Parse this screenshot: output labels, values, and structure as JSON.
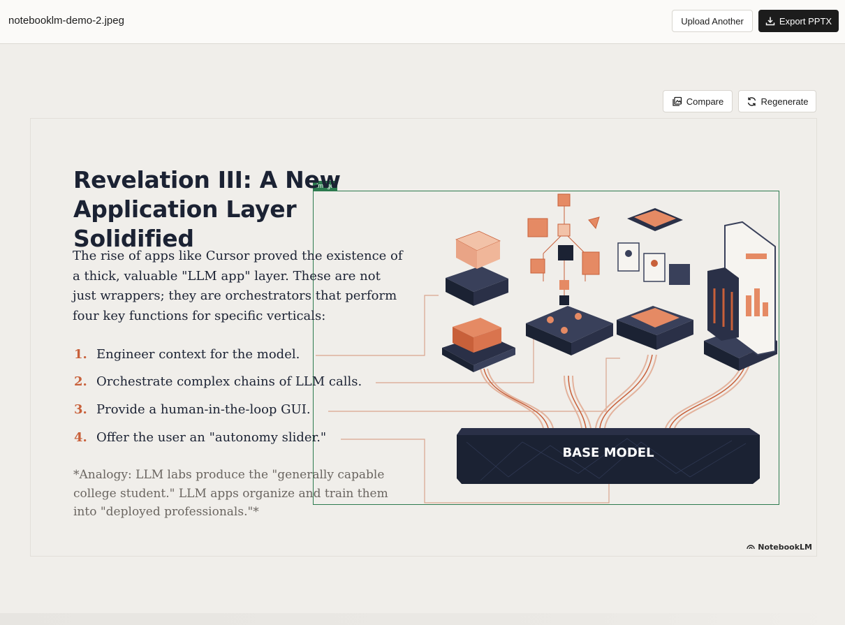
{
  "header": {
    "filename": "notebooklm-demo-2.jpeg",
    "upload_label": "Upload Another",
    "export_label": "Export PPTX"
  },
  "toolbar": {
    "compare_label": "Compare",
    "regenerate_label": "Regenerate"
  },
  "slide": {
    "title": "Revelation III: A New Application Layer Solidified",
    "intro": "The rise of apps like Cursor proved the existence of a thick, valuable \"LLM app\" layer. These are not just wrappers; they are orchestrators that perform four key functions for specific verticals:",
    "items": [
      {
        "num": "1.",
        "text": "Engineer context for the model."
      },
      {
        "num": "2.",
        "text": "Orchestrate complex chains of LLM calls."
      },
      {
        "num": "3.",
        "text": "Provide a human-in-the-loop GUI."
      },
      {
        "num": "4.",
        "text": "Offer the user an \"autonomy slider.\""
      }
    ],
    "analogy": "*Analogy: LLM labs produce the \"generally capable college student.\" LLM apps organize and train them into \"deployed professionals.\"*",
    "illustration_label": "BASE MODEL",
    "selection_tag": "Image",
    "brand": "NotebookLM"
  },
  "colors": {
    "accent": "#c8603a",
    "navy": "#1b2233",
    "selection": "#2c7a4e"
  }
}
